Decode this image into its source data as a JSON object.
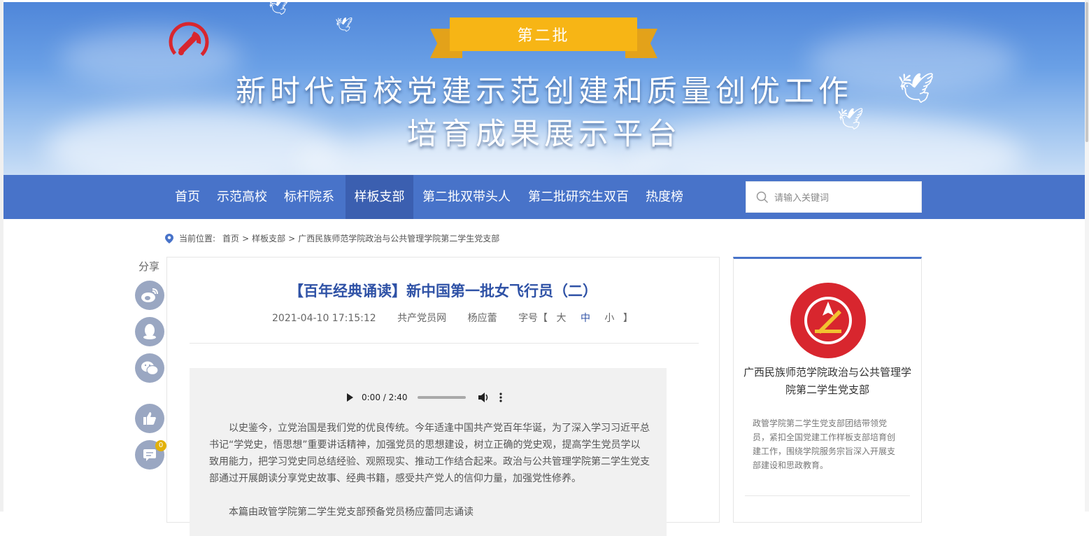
{
  "banner": {
    "ribbon_text": "第二批",
    "title_line1": "新时代高校党建示范创建和质量创优工作",
    "title_line2": "培育成果展示平台"
  },
  "nav": {
    "items": [
      "首页",
      "示范高校",
      "标杆院系",
      "样板支部",
      "第二批双带头人",
      "第二批研究生双百",
      "热度榜"
    ],
    "active": "样板支部",
    "search_placeholder": "请输入关键词"
  },
  "breadcrumb": {
    "prefix": "当前位置:",
    "home": "首页",
    "sep": ">",
    "section": "样板支部",
    "current": "广西民族师范学院政治与公共管理学院第二学生党支部"
  },
  "share": {
    "label": "分享",
    "comment_count": "0"
  },
  "article": {
    "title": "【百年经典诵读】新中国第一批女飞行员（二）",
    "date": "2021-04-10 17:15:12",
    "source": "共产党员网",
    "author": "杨应蕾",
    "font_size_label": "字号【",
    "font_sizes": [
      "大",
      "中",
      "小"
    ],
    "font_size_close": "】",
    "audio_time": "0:00 / 2:40",
    "paragraph1": "以史鉴今，立党治国是我们党的优良传统。今年适逢中国共产党百年华诞，为了深入学习习近平总书记“学党史，悟思想”重要讲话精神，加强党员的思想建设，树立正确的党史观，提高学生党员学以致用能力，把学习党史同总结经验、观照现实、推动工作结合起来。政治与公共管理学院第二学生党支部通过开展朗读分享党史故事、经典书籍，感受共产党人的信仰力量，加强党性修养。",
    "paragraph2": "本篇由政管学院第二学生党支部预备党员杨应蕾同志诵读"
  },
  "sidebar": {
    "org_name": "广西民族师范学院政治与公共管理学院第二学生党支部",
    "description": "政管学院第二学生党支部团结带领党员，紧扣全国党建工作样板支部培育创建工作，围绕学院服务宗旨深入开展支部建设和思政教育。"
  },
  "colors": {
    "nav_bg": "#4873c9",
    "nav_active": "#3b5fb0",
    "title_blue": "#2f52a6",
    "ribbon": "#f7b515"
  }
}
